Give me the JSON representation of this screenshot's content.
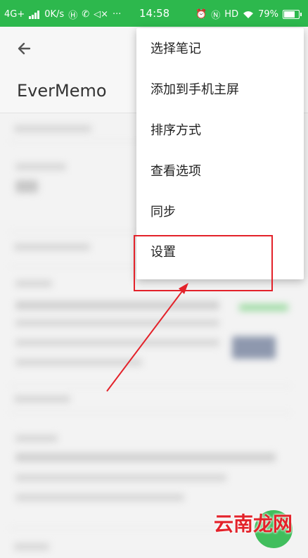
{
  "status_bar": {
    "network": "4G+",
    "speed": "0K/s",
    "time": "14:58",
    "hd": "HD",
    "battery_percent": "79%",
    "battery_level": 0.79
  },
  "app_bar": {
    "title": "EverMemo"
  },
  "menu": {
    "items": [
      {
        "label": "选择笔记"
      },
      {
        "label": "添加到手机主屏"
      },
      {
        "label": "排序方式"
      },
      {
        "label": "查看选项"
      },
      {
        "label": "同步"
      },
      {
        "label": "设置"
      }
    ]
  },
  "watermark": {
    "text": "云南龙网"
  },
  "colors": {
    "status_bar": "#2db84d",
    "annotation": "#e3222a",
    "fab": "#2db84d"
  }
}
